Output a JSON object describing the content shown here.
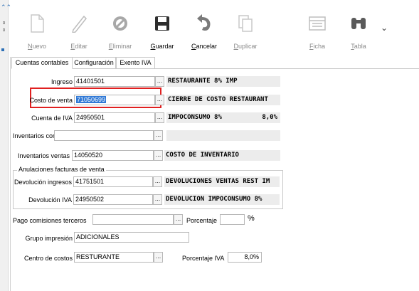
{
  "toolbar": {
    "items": [
      {
        "label": "Nuevo",
        "icon": "new-document-icon",
        "enabled": false
      },
      {
        "label": "Editar",
        "icon": "pencil-icon",
        "enabled": false
      },
      {
        "label": "Eliminar",
        "icon": "no-entry-icon",
        "enabled": false
      },
      {
        "label": "Guardar",
        "icon": "floppy-disk-icon",
        "enabled": true
      },
      {
        "label": "Cancelar",
        "icon": "undo-arrow-icon",
        "enabled": true
      },
      {
        "label": "Duplicar",
        "icon": "copy-document-icon",
        "enabled": false
      },
      {
        "label": "Ficha",
        "icon": "card-form-icon",
        "enabled": false
      },
      {
        "label": "Tabla",
        "icon": "binoculars-icon",
        "enabled": false
      }
    ],
    "more": "⌄"
  },
  "tabs": [
    "Cuentas contables",
    "Configuración",
    "Exento IVA"
  ],
  "active_tab": "Cuentas contables",
  "form": {
    "ingreso": {
      "label": "Ingreso",
      "value": "41401501",
      "desc": "RESTAURANTE 8% IMP"
    },
    "costo_venta": {
      "label": "Costo de venta",
      "value": "71050699",
      "desc": "CIERRE DE COSTO RESTAURANT"
    },
    "cuenta_iva": {
      "label": "Cuenta de IVA",
      "value": "24950501",
      "desc": "IMPOCONSUMO 8%",
      "pct": "8,0%"
    },
    "inv_compras": {
      "label": "Inventarios compras",
      "value": "",
      "desc": ""
    },
    "inv_ventas": {
      "label": "Inventarios ventas",
      "value": "14050520",
      "desc": "COSTO DE INVENTARIO"
    },
    "anulaciones": {
      "legend": "Anulaciones facturas de venta",
      "dev_ingresos": {
        "label": "Devolución ingresos",
        "value": "41751501",
        "desc": "DEVOLUCIONES VENTAS REST IM"
      },
      "dev_iva": {
        "label": "Devolución IVA",
        "value": "24950502",
        "desc": "DEVOLUCION IMPOCONSUMO 8%"
      }
    },
    "pago_comisiones": {
      "label": "Pago comisiones terceros",
      "value": ""
    },
    "porcentaje": {
      "label": "Porcentaje",
      "value": "",
      "unit": "%"
    },
    "grupo_impresion": {
      "label": "Grupo impresión",
      "value": "ADICIONALES"
    },
    "centro_costos": {
      "label": "Centro de costos",
      "value": "RESTURANTE"
    },
    "porcentaje_iva": {
      "label": "Porcentaje IVA",
      "value": "8,0%"
    }
  },
  "lookup_button": "...",
  "colors": {
    "highlight": "#e02020",
    "selection": "#3079d6",
    "description_bg": "#ececec"
  }
}
